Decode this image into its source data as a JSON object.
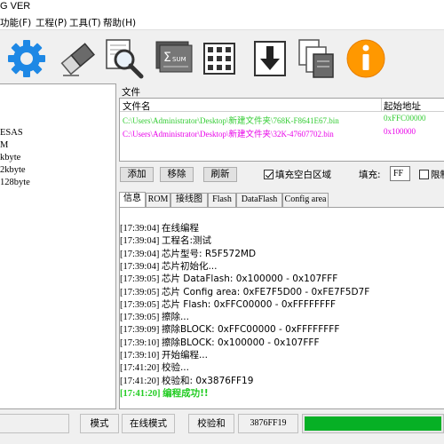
{
  "window": {
    "title": "G VER"
  },
  "menu": [
    "功能(F)",
    "工程(P)",
    "工具(T)",
    "帮助(H)"
  ],
  "toolbar": {
    "icons": [
      "gear-icon",
      "eraser-icon",
      "magnifier-icon",
      "checksum-sum-icon",
      "chip-icon",
      "download-icon",
      "copy-pages-icon",
      "info-icon"
    ],
    "sum_text": "SUM"
  },
  "left_panel": {
    "lines": [
      "ESAS",
      "M",
      "kbyte",
      "2kbyte",
      "128byte"
    ]
  },
  "files": {
    "label": "文件",
    "headers": {
      "name": "文件名",
      "start": "起始地址"
    },
    "rows": [
      {
        "path_prefix": "C:\\Users\\Administrator\\Desktop\\",
        "folder": "新建文件夹",
        "file": "\\768K-F8641E67.bin",
        "addr": "0xFFC00000",
        "color": "#33cc33"
      },
      {
        "path_prefix": "C:\\Users\\Administrator\\Desktop\\",
        "folder": "新建文件夹",
        "file": "\\32K-47607702.bin",
        "addr": "0x100000",
        "color": "#e800e8"
      }
    ]
  },
  "controls": {
    "add": "添加",
    "remove": "移除",
    "refresh": "刷新",
    "fill_blank": "填充空白区域",
    "fill_blank_checked": true,
    "fill_label": "填充:",
    "fill_value": "FF",
    "limit": "限制"
  },
  "tabs": [
    "信息",
    "ROM",
    "接线图",
    "Flash",
    "DataFlash",
    "Config area"
  ],
  "log": [
    {
      "time": "[17:39:04]",
      "text": "在线编程"
    },
    {
      "time": "[17:39:04]",
      "text": "工程名:测试"
    },
    {
      "time": "[17:39:04]",
      "text": "芯片型号: R5F572MD"
    },
    {
      "time": "[17:39:04]",
      "text": "芯片初始化..."
    },
    {
      "time": "[17:39:05]",
      "text": "芯片 DataFlash: 0x100000 - 0x107FFF"
    },
    {
      "time": "[17:39:05]",
      "text": "芯片 Config area: 0xFE7F5D00 - 0xFE7F5D7F"
    },
    {
      "time": "[17:39:05]",
      "text": "芯片 Flash: 0xFFC00000 - 0xFFFFFFFF"
    },
    {
      "time": "[17:39:05]",
      "text": "擦除..."
    },
    {
      "time": "[17:39:09]",
      "text": "擦除BLOCK: 0xFFC00000 - 0xFFFFFFFF"
    },
    {
      "time": "[17:39:10]",
      "text": "擦除BLOCK: 0x100000 - 0x107FFF"
    },
    {
      "time": "[17:39:10]",
      "text": "开始编程..."
    },
    {
      "time": "[17:41:20]",
      "text": "校验..."
    },
    {
      "time": "[17:41:20]",
      "text": "校验和: 0x3876FF19"
    },
    {
      "time": "[17:41:20]",
      "text": "编程成功!!",
      "success": true
    }
  ],
  "status": {
    "mode_label": "模式",
    "mode_value": "在线模式",
    "checksum_label": "校验和",
    "checksum_value": "3876FF19",
    "progress": 1.0
  },
  "colors": {
    "success": "#22cc22",
    "progress": "#06b025",
    "gear": "#1e88e5",
    "info": "#ff9800"
  }
}
